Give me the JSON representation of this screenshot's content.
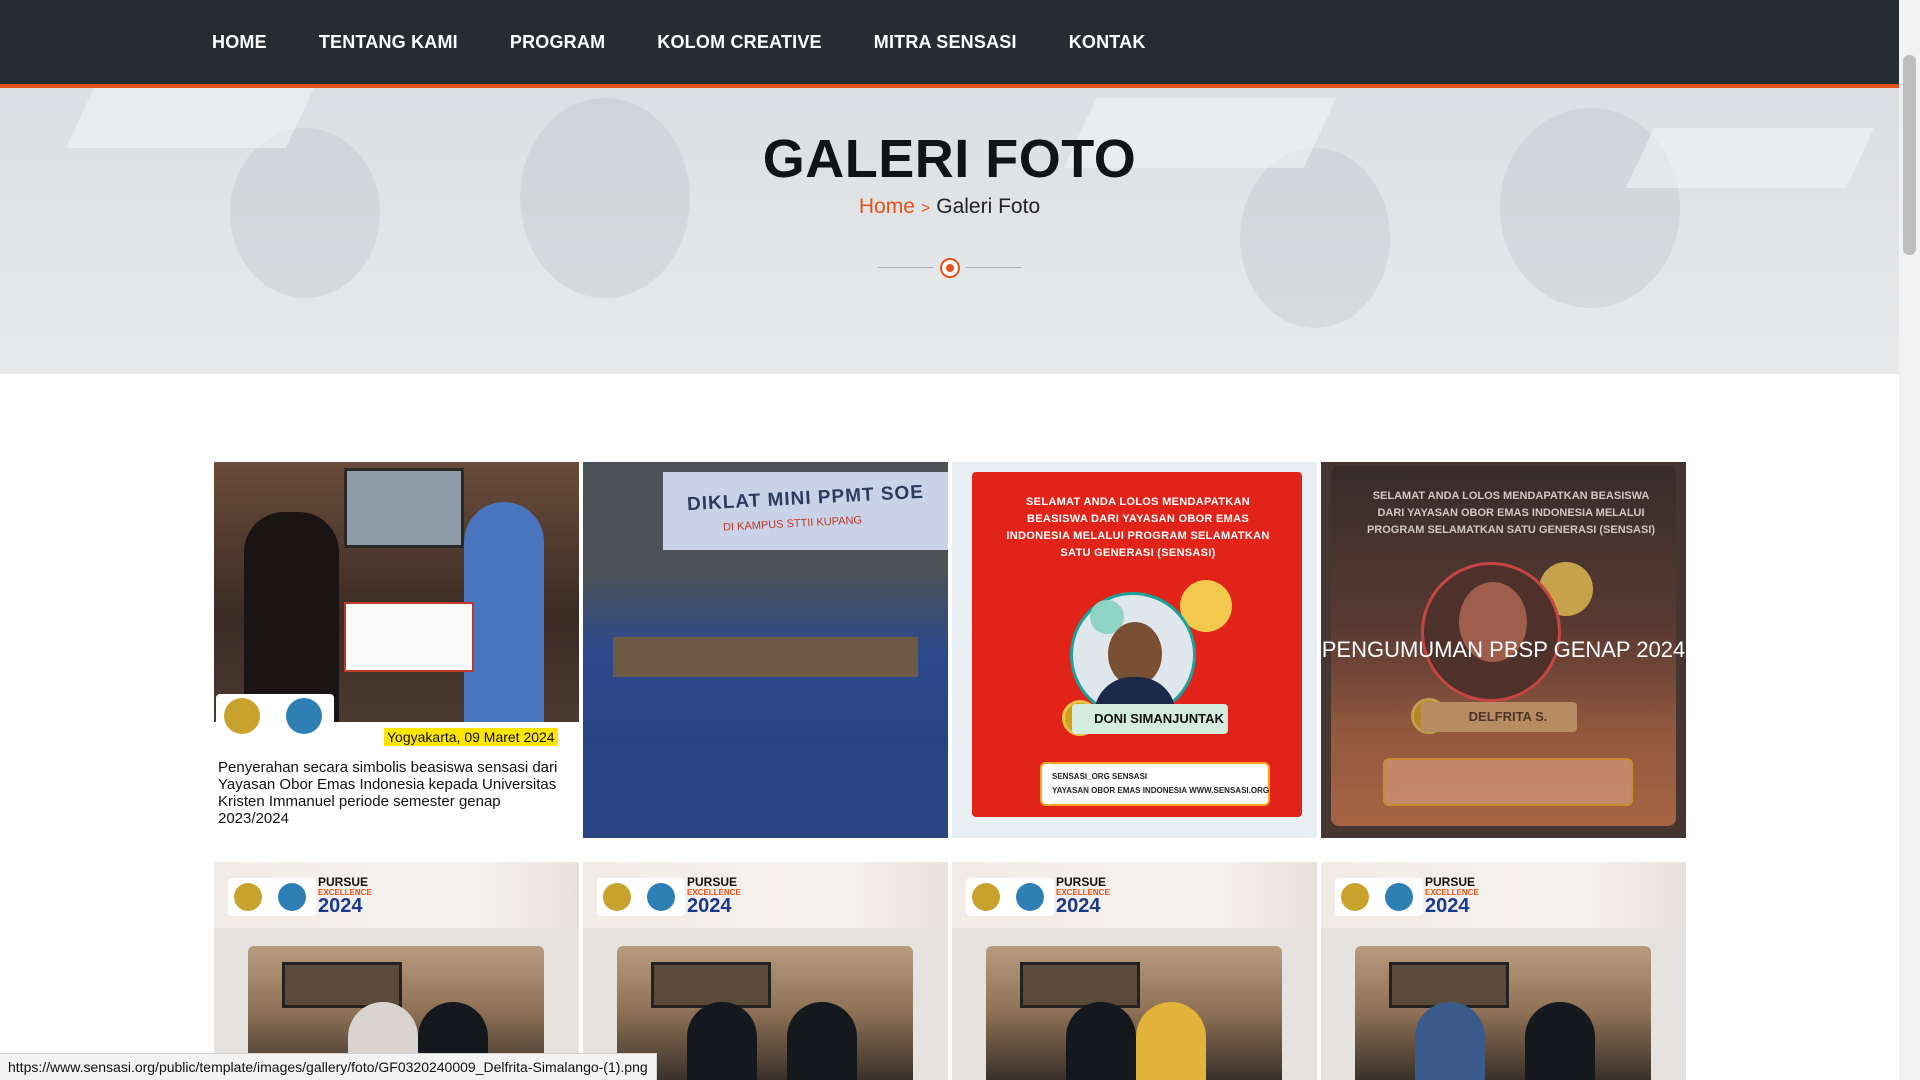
{
  "nav": {
    "items": [
      {
        "label": "HOME"
      },
      {
        "label": "TENTANG KAMI"
      },
      {
        "label": "PROGRAM"
      },
      {
        "label": "KOLOM CREATIVE"
      },
      {
        "label": "MITRA SENSASI"
      },
      {
        "label": "KONTAK"
      }
    ]
  },
  "hero": {
    "title": "GALERI FOTO",
    "breadcrumb": {
      "home": "Home",
      "separator": ">",
      "current": "Galeri Foto"
    }
  },
  "gallery": {
    "tiles": [
      {
        "date": "Yogyakarta, 09 Maret 2024",
        "caption": "Penyerahan secara simbolis beasiswa sensasi dari Yayasan Obor Emas Indonesia  kepada Universitas Kristen Immanuel periode semester genap 2023/2024"
      },
      {
        "banner": "DIKLAT MINI PPMT SOE",
        "banner_sub": "DI KAMPUS STTII KUPANG"
      },
      {
        "headline": "SELAMAT ANDA LOLOS MENDAPATKAN BEASISWA DARI YAYASAN OBOR EMAS INDONESIA MELALUI PROGRAM SELAMATKAN SATU GENERASI (SENSASI)",
        "name": "DONI SIMANJUNTAK",
        "social_line_1": "SENSASI_ORG   SENSASI",
        "social_line_2": "YAYASAN OBOR EMAS INDONESIA   WWW.SENSASI.ORG"
      },
      {
        "headline": "SELAMAT ANDA LOLOS MENDAPATKAN BEASISWA DARI YAYASAN OBOR EMAS INDONESIA MELALUI PROGRAM SELAMATKAN SATU GENERASI (SENSASI)",
        "name": "DELFRITA S.",
        "hover_title": "PENGUMUMAN PBSP GENAP 2024"
      }
    ],
    "row2": [
      {
        "pursue": "PURSUE",
        "excellence": "EXCELLENCE",
        "year": "2024"
      },
      {
        "pursue": "PURSUE",
        "excellence": "EXCELLENCE",
        "year": "2024"
      },
      {
        "pursue": "PURSUE",
        "excellence": "EXCELLENCE",
        "year": "2024"
      },
      {
        "pursue": "PURSUE",
        "excellence": "EXCELLENCE",
        "year": "2024"
      }
    ]
  },
  "status_bar": {
    "url": "https://www.sensasi.org/public/template/images/gallery/foto/GF0320240009_Delfrita-Simalango-(1).png"
  },
  "colors": {
    "nav_bg": "#252d33",
    "accent": "#e4521b"
  }
}
